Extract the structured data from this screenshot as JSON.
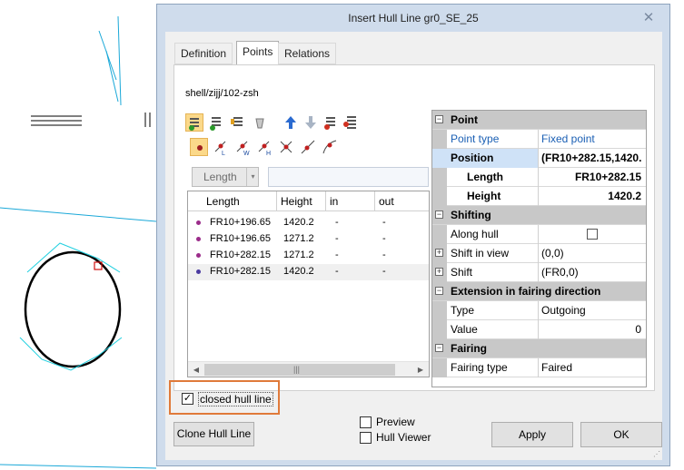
{
  "dialog": {
    "title": "Insert Hull Line gr0_SE_25",
    "close_glyph": "✕",
    "tabs": [
      {
        "label": "Definition",
        "active": false
      },
      {
        "label": "Points",
        "active": true
      },
      {
        "label": "Relations",
        "active": false
      }
    ],
    "path": "shell/zijj/102-zsh",
    "toolbar_icons": [
      "add-point-icon",
      "insert-point-icon",
      "edit-point-icon",
      "pick-point-icon",
      "move-up-icon",
      "move-down-icon",
      "delete-point-icon",
      "delete-all-icon",
      "point-mode-icon",
      "point-l-icon",
      "point-w-icon",
      "point-h-icon",
      "cross-icon",
      "diagonal-line-icon",
      "diagonal-curve-icon"
    ],
    "length_combo": {
      "value": "Length",
      "arrow": "▾"
    },
    "points_table": {
      "columns": [
        "Length",
        "Height",
        "in",
        "out"
      ],
      "rows": [
        {
          "length": "FR10+196.65",
          "height": "1420.2",
          "in": "-",
          "out": "-"
        },
        {
          "length": "FR10+196.65",
          "height": "1271.2",
          "in": "-",
          "out": "-"
        },
        {
          "length": "FR10+282.15",
          "height": "1271.2",
          "in": "-",
          "out": "-"
        },
        {
          "length": "FR10+282.15",
          "height": "1420.2",
          "in": "-",
          "out": "-"
        }
      ],
      "scroll_left": "◀",
      "scroll_right": "▶",
      "thumb_grip": "|||"
    },
    "properties": {
      "point": {
        "header": "Point",
        "type_label": "Point type",
        "type_value": "Fixed point"
      },
      "position": {
        "label": "Position",
        "value": "(FR10+282.15,1420.",
        "length_label": "Length",
        "length_value": "FR10+282.15",
        "height_label": "Height",
        "height_value": "1420.2"
      },
      "shifting": {
        "header": "Shifting",
        "along_hull_label": "Along hull",
        "shift_in_view_label": "Shift in view",
        "shift_in_view_value": "(0,0)",
        "shift_label": "Shift",
        "shift_value": "(FR0,0)"
      },
      "extension": {
        "header": "Extension in fairing direction",
        "type_label": "Type",
        "type_value": "Outgoing",
        "value_label": "Value",
        "value_value": "0"
      },
      "fairing": {
        "header": "Fairing",
        "type_label": "Fairing type",
        "type_value": "Faired"
      },
      "expander_minus": "−",
      "expander_plus": "+"
    },
    "closed_hull_line": {
      "label": "closed hull line",
      "checked": true,
      "check_glyph": "✓"
    },
    "buttons": {
      "clone": "Clone Hull Line",
      "apply": "Apply",
      "ok": "OK"
    },
    "options": {
      "preview_label": "Preview",
      "hull_viewer_label": "Hull Viewer"
    }
  }
}
